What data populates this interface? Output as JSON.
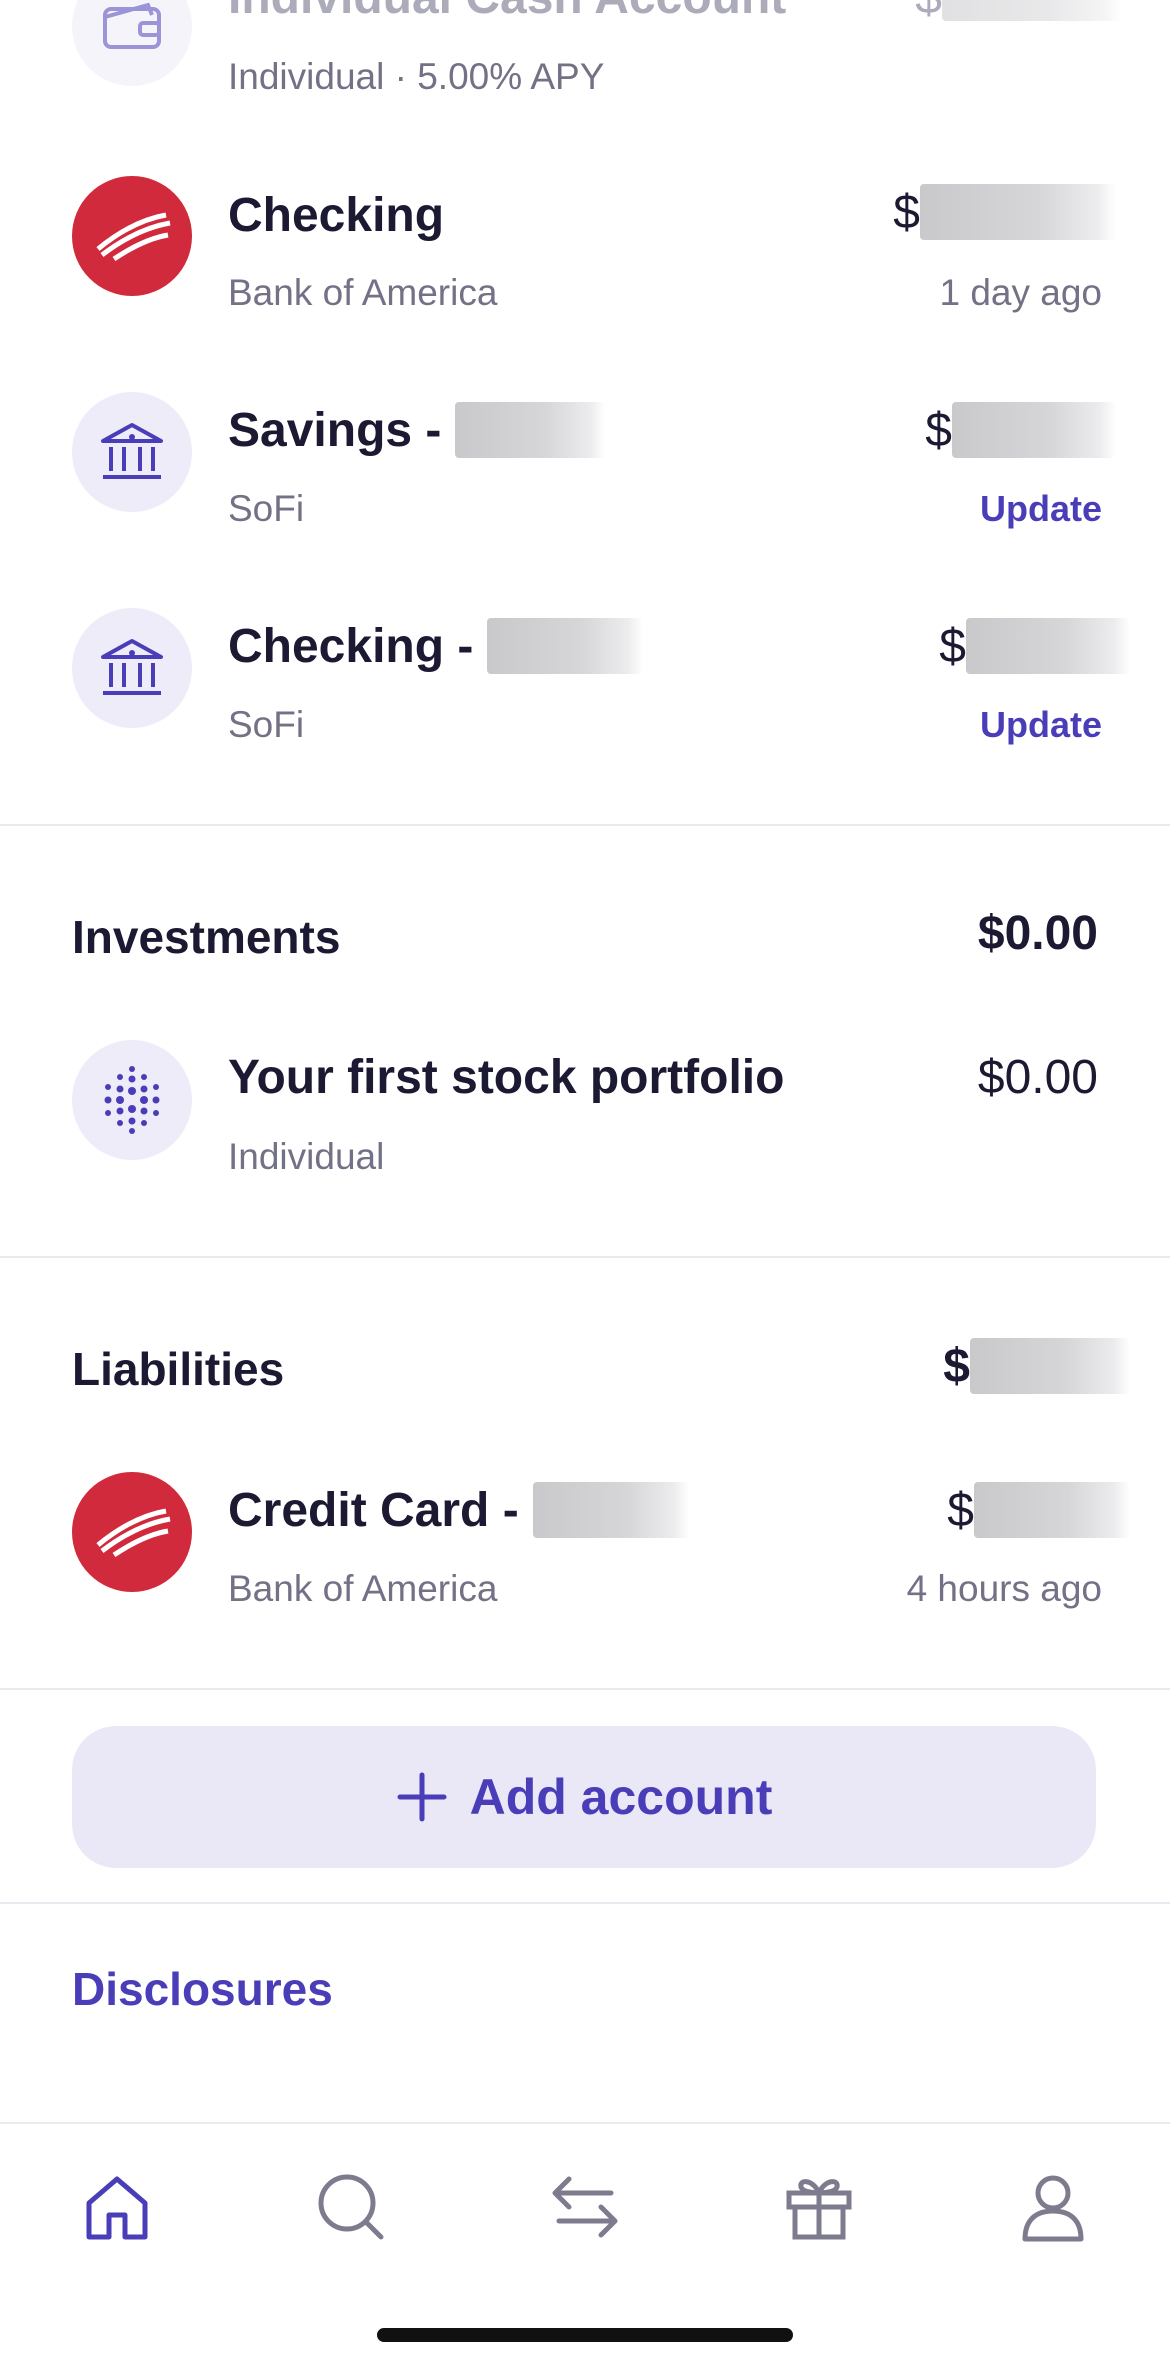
{
  "accounts": [
    {
      "name": "Individual Cash Account",
      "subtitle": "Individual · 5.00% APY",
      "currency": "$",
      "icon": "wallet-icon"
    },
    {
      "name": "Checking",
      "subtitle": "Bank of America",
      "currency": "$",
      "status": "1 day ago",
      "icon": "bank-of-america-logo"
    },
    {
      "name": "Savings -",
      "subtitle": "SoFi",
      "currency": "$",
      "action": "Update",
      "icon": "bank-building-icon"
    },
    {
      "name": "Checking -",
      "subtitle": "SoFi",
      "currency": "$",
      "action": "Update",
      "icon": "bank-building-icon"
    }
  ],
  "investments": {
    "label": "Investments",
    "total": "$0.00",
    "items": [
      {
        "name": "Your first stock portfolio",
        "subtitle": "Individual",
        "amount": "$0.00",
        "icon": "dots-grid-icon"
      }
    ]
  },
  "liabilities": {
    "label": "Liabilities",
    "currency": "$",
    "items": [
      {
        "name": "Credit Card -",
        "subtitle": "Bank of America",
        "currency": "$",
        "status": "4 hours ago",
        "icon": "bank-of-america-logo"
      }
    ]
  },
  "add_account_label": "Add account",
  "disclosures_label": "Disclosures",
  "tabbar": [
    {
      "name": "home",
      "icon": "home-icon",
      "active": true
    },
    {
      "name": "search",
      "icon": "search-icon",
      "active": false
    },
    {
      "name": "transfer",
      "icon": "transfer-arrows-icon",
      "active": false
    },
    {
      "name": "rewards",
      "icon": "gift-icon",
      "active": false
    },
    {
      "name": "profile",
      "icon": "person-icon",
      "active": false
    }
  ],
  "colors": {
    "accent": "#4a3db8",
    "boa_red": "#d12a3c",
    "icon_bg": "#eeecf8",
    "text": "#1c1a33",
    "muted": "#737185"
  }
}
